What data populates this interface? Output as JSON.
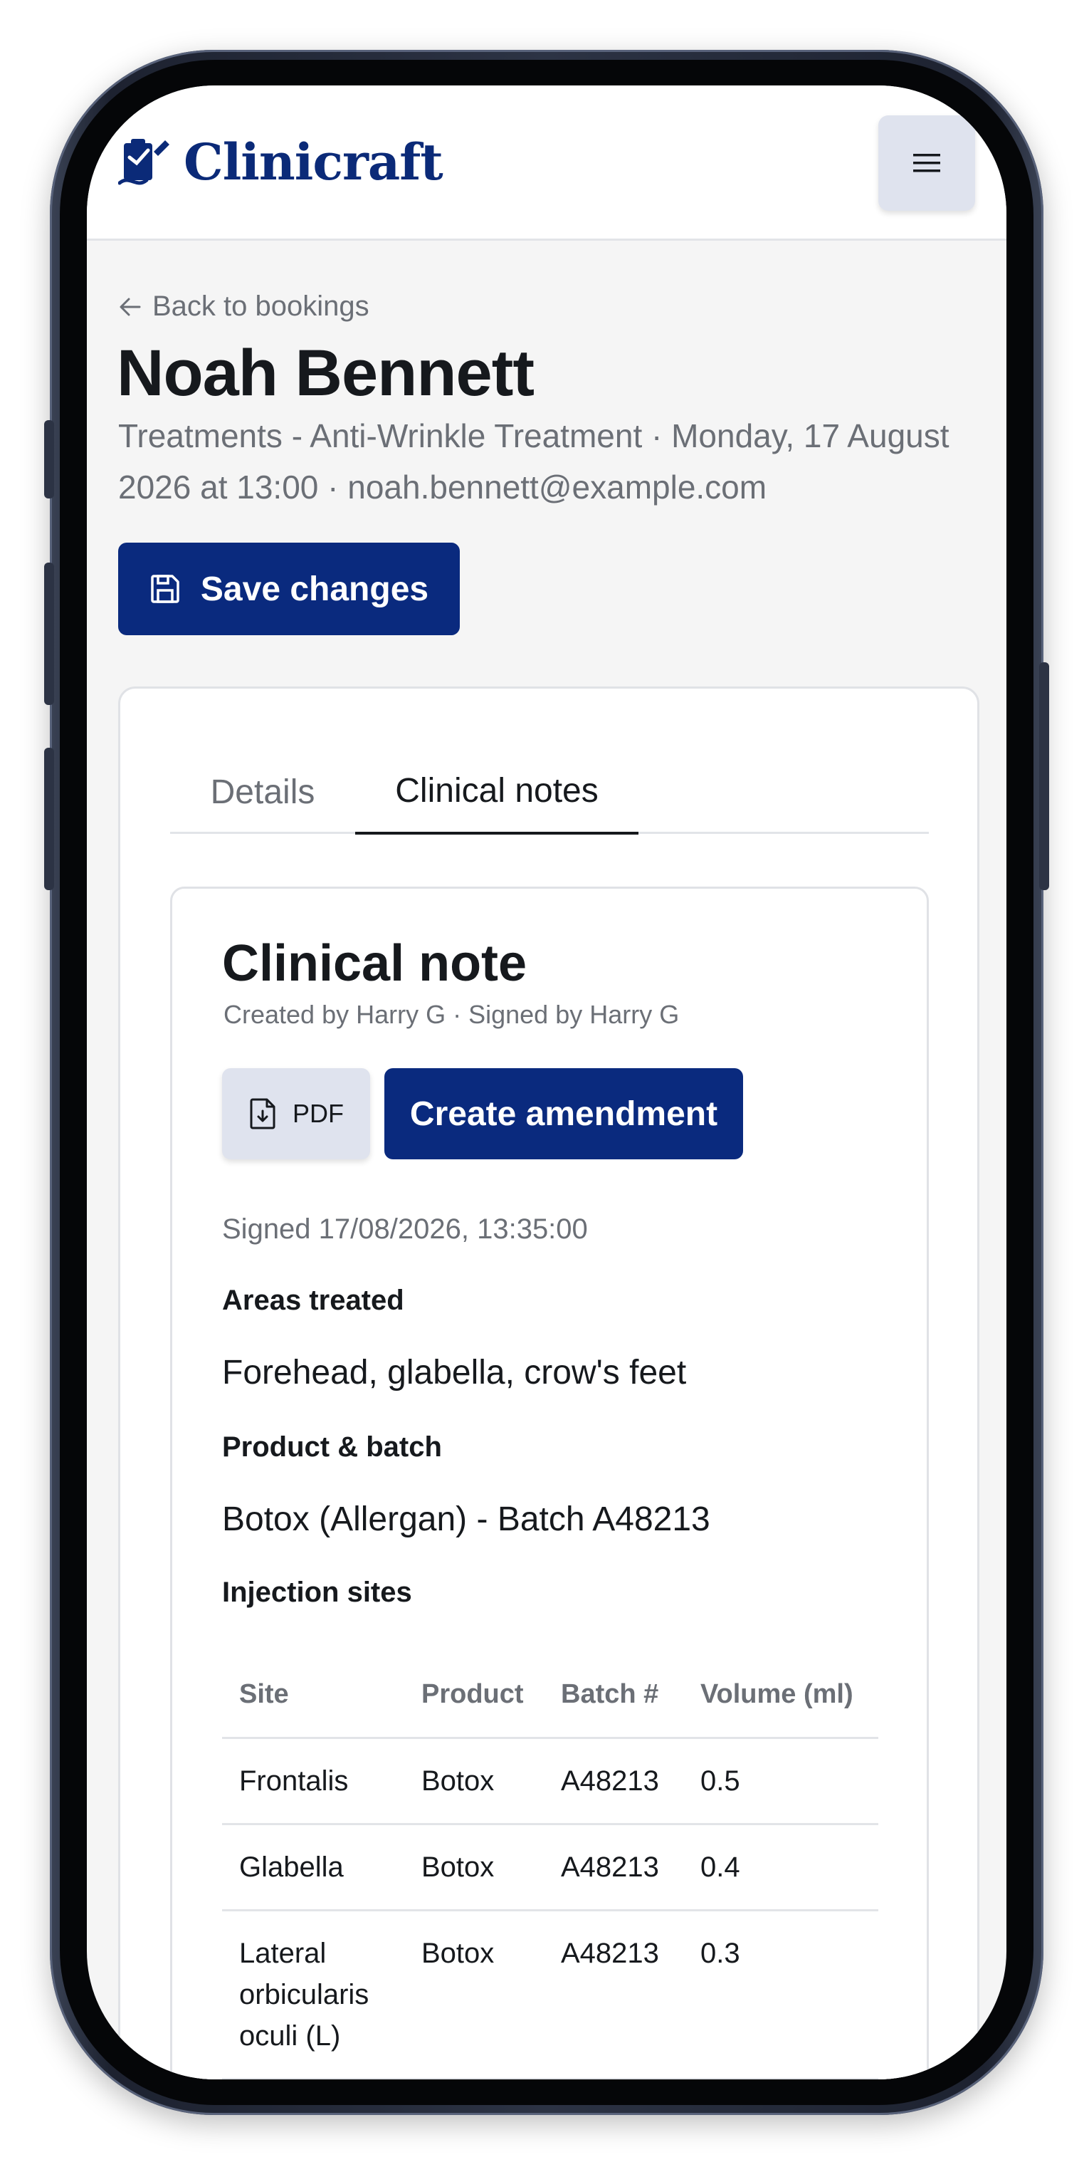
{
  "app": {
    "brand_name": "Clinicraft"
  },
  "header": {
    "menu_label": "Menu"
  },
  "page": {
    "back_label": "Back to bookings",
    "patient_name": "Noah Bennett",
    "booking_meta": "Treatments - Anti-Wrinkle Treatment · Monday, 17 August 2026 at 13:00 · noah.bennett@example.com",
    "save_label": "Save changes"
  },
  "tabs": [
    {
      "label": "Details",
      "active": false
    },
    {
      "label": "Clinical notes",
      "active": true
    }
  ],
  "note": {
    "title": "Clinical note",
    "subtitle": "Created by Harry G · Signed by Harry G",
    "pdf_label": "PDF",
    "amend_label": "Create amendment",
    "signed": "Signed 17/08/2026, 13:35:00",
    "areas_label": "Areas treated",
    "areas_value": "Forehead, glabella, crow's feet",
    "product_label": "Product & batch",
    "product_value": "Botox (Allergan) - Batch A48213",
    "sites_label": "Injection sites",
    "table": {
      "headers": [
        "Site",
        "Product",
        "Batch #",
        "Volume (ml)"
      ],
      "rows": [
        [
          "Frontalis",
          "Botox",
          "A48213",
          "0.5"
        ],
        [
          "Glabella",
          "Botox",
          "A48213",
          "0.4"
        ],
        [
          "Lateral orbicularis oculi (L)",
          "Botox",
          "A48213",
          "0.3"
        ]
      ]
    }
  },
  "icons": {
    "logo": "clipboard-pen-icon",
    "menu": "hamburger-icon",
    "back": "arrow-left-icon",
    "save": "floppy-disk-icon",
    "pdf": "file-download-icon"
  },
  "colors": {
    "brand": "#0a2a7e",
    "muted_text": "#6b6f76",
    "text": "#16191d",
    "secondary_button": "#dfe3ee"
  }
}
